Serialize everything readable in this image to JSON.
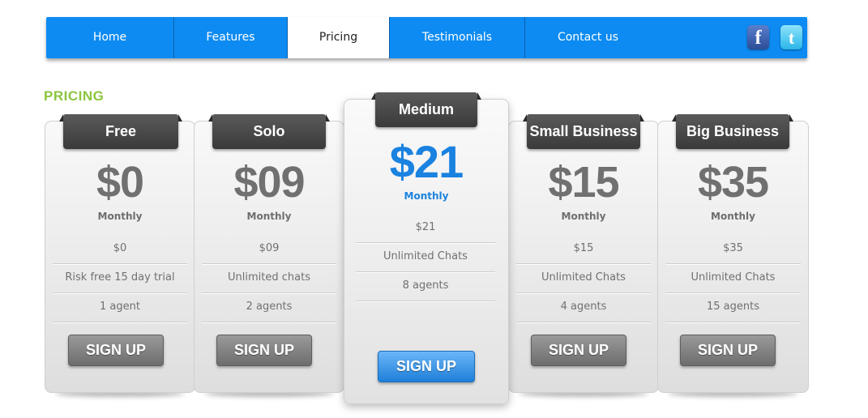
{
  "nav": {
    "items": [
      {
        "label": "Home",
        "active": false
      },
      {
        "label": "Features",
        "active": false
      },
      {
        "label": "Pricing",
        "active": true
      },
      {
        "label": "Testimonials",
        "active": false
      },
      {
        "label": "Contact us",
        "active": false
      }
    ],
    "social": [
      {
        "glyph": "f",
        "icon": "facebook-icon"
      },
      {
        "glyph": "t",
        "icon": "twitter-icon"
      }
    ]
  },
  "section": {
    "title": "PRICING"
  },
  "colors": {
    "nav": "#0d8bf2",
    "accent_green": "#8cc63f",
    "featured_blue": "#1a82e0"
  },
  "plans": [
    {
      "name": "Free",
      "price": "$0",
      "period": "Monthly",
      "features": [
        "$0",
        "Risk free 15 day trial",
        "1 agent"
      ],
      "cta": "SIGN UP",
      "featured": false
    },
    {
      "name": "Solo",
      "price": "$09",
      "period": "Monthly",
      "features": [
        "$09",
        "Unlimited chats",
        "2 agents"
      ],
      "cta": "SIGN UP",
      "featured": false
    },
    {
      "name": "Medium",
      "price": "$21",
      "period": "Monthly",
      "features": [
        "$21",
        "Unlimited Chats",
        "8 agents"
      ],
      "cta": "SIGN UP",
      "featured": true
    },
    {
      "name": "Small Business",
      "price": "$15",
      "period": "Monthly",
      "features": [
        "$15",
        "Unlimited Chats",
        "4 agents"
      ],
      "cta": "SIGN UP",
      "featured": false
    },
    {
      "name": "Big Business",
      "price": "$35",
      "period": "Monthly",
      "features": [
        "$35",
        "Unlimited Chats",
        "15 agents"
      ],
      "cta": "SIGN UP",
      "featured": false
    }
  ]
}
